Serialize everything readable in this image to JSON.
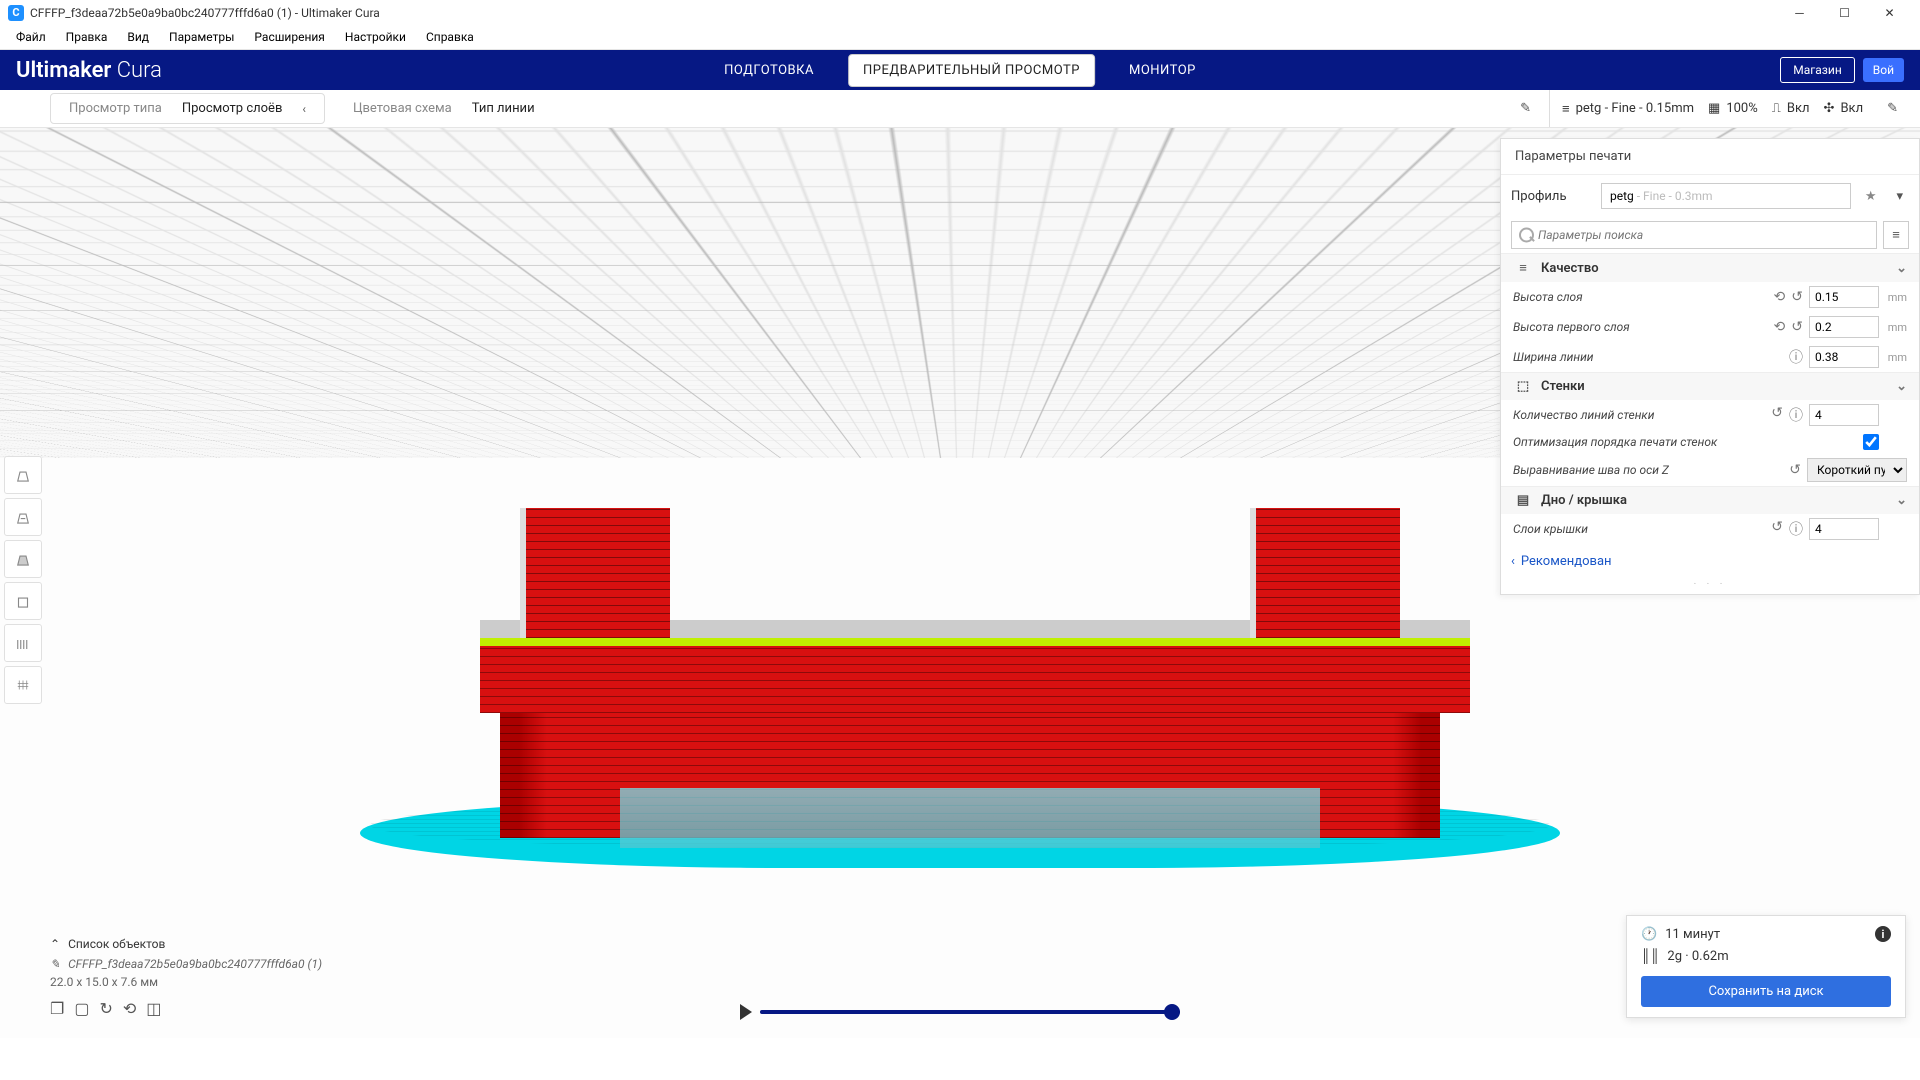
{
  "titlebar": {
    "doc_title": "CFFFP_f3deaa72b5e0a9ba0bc240777fffd6a0 (1) - Ultimaker Cura",
    "app_icon_letter": "C"
  },
  "menubar": [
    "Файл",
    "Правка",
    "Вид",
    "Параметры",
    "Расширения",
    "Настройки",
    "Справка"
  ],
  "header": {
    "brand_bold": "Ultimaker",
    "brand_light": "Cura",
    "tabs": [
      {
        "label": "ПОДГОТОВКА",
        "active": false
      },
      {
        "label": "ПРЕДВАРИТЕЛЬНЫЙ ПРОСМОТР",
        "active": true
      },
      {
        "label": "МОНИТОР",
        "active": false
      }
    ],
    "store": "Магазин",
    "login": "Вой"
  },
  "toolbar": {
    "view_type_label": "Просмотр типа",
    "view_type_value": "Просмотр слоёв",
    "color_scheme_label": "Цветовая схема",
    "color_scheme_value": "Тип линии",
    "profile_summary": "petg - Fine - 0.15mm",
    "infill_pct": "100%",
    "support_label": "Вкл",
    "adhesion_label": "Вкл"
  },
  "side_panel": {
    "title": "Параметры печати",
    "profile_label": "Профиль",
    "profile_value": "petg",
    "profile_muted": "- Fine - 0.3mm",
    "search_placeholder": "Параметры поиска",
    "sections": {
      "quality": {
        "title": "Качество",
        "rows": {
          "layer_height": {
            "label": "Высота слоя",
            "value": "0.15",
            "unit": "mm"
          },
          "first_layer_height": {
            "label": "Высота первого слоя",
            "value": "0.2",
            "unit": "mm"
          },
          "line_width": {
            "label": "Ширина линии",
            "value": "0.38",
            "unit": "mm"
          }
        }
      },
      "walls": {
        "title": "Стенки",
        "rows": {
          "wall_line_count": {
            "label": "Количество линий стенки",
            "value": "4"
          },
          "optimize_order": {
            "label": "Оптимизация порядка печати стенок",
            "checked": true
          },
          "z_seam": {
            "label": "Выравнивание шва по оси Z",
            "value": "Короткий путь"
          }
        }
      },
      "topbottom": {
        "title": "Дно / крышка",
        "rows": {
          "top_layers": {
            "label": "Слои крышки",
            "value": "4"
          }
        }
      }
    },
    "recommended": "Рекомендован"
  },
  "object_list": {
    "header": "Список объектов",
    "item_name": "CFFFP_f3deaa72b5e0a9ba0bc240777fffd6a0 (1)",
    "dims": "22.0 x 15.0 x 7.6 мм"
  },
  "result": {
    "time": "11 минут",
    "material": "2g · 0.62m",
    "save": "Сохранить на диск"
  }
}
